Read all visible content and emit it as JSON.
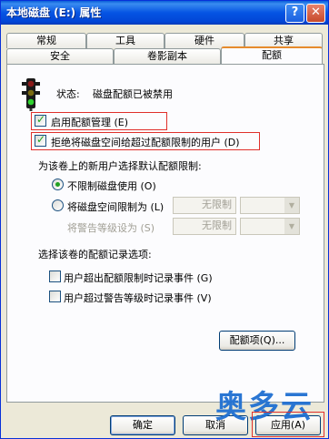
{
  "window": {
    "title": "本地磁盘 (E:) 属性"
  },
  "tabs_row1": [
    {
      "label": "常规"
    },
    {
      "label": "工具"
    },
    {
      "label": "硬件"
    },
    {
      "label": "共享"
    }
  ],
  "tabs_row2": [
    {
      "label": "安全"
    },
    {
      "label": "卷影副本"
    },
    {
      "label": "配额",
      "active": true
    }
  ],
  "status": {
    "label": "状态:",
    "value": "磁盘配额已被禁用"
  },
  "checkboxes": {
    "enable_quota": {
      "label": "启用配额管理",
      "hotkey": "(E)",
      "checked": true
    },
    "deny_space": {
      "label": "拒绝将磁盘空间给超过配额限制的用户",
      "hotkey": "(D)",
      "checked": true
    }
  },
  "default_limit": {
    "heading": "为该卷上的新用户选择默认配额限制:",
    "no_limit": {
      "label": "不限制磁盘使用",
      "hotkey": "(O)",
      "checked": true
    },
    "limit_to": {
      "label": "将磁盘空间限制为",
      "hotkey": "(L)",
      "value": "无限制"
    },
    "warning": {
      "label": "将警告等级设为",
      "hotkey": "(S)",
      "value": "无限制"
    }
  },
  "logging": {
    "heading": "选择该卷的配额记录选项:",
    "over_limit": {
      "label": "用户超出配额限制时记录事件",
      "hotkey": "(G)",
      "checked": false
    },
    "over_warning": {
      "label": "用户超过警告等级时记录事件",
      "hotkey": "(V)",
      "checked": false
    }
  },
  "buttons": {
    "quota_entries": "配额项(Q)...",
    "ok": "确定",
    "cancel": "取消",
    "apply": "应用(A)"
  },
  "watermark": "奥多云"
}
